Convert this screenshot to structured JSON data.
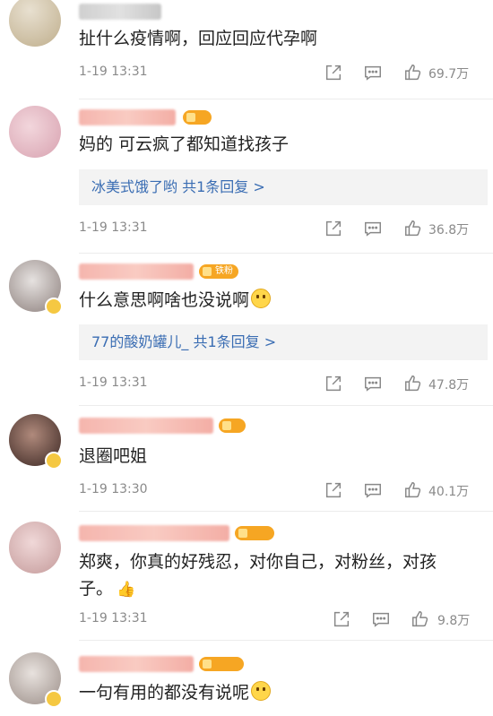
{
  "icons": {
    "share": "share-icon",
    "comment": "comment-icon",
    "like": "thumbs-up-icon"
  },
  "colors": {
    "link": "#3a6db3",
    "meta": "#8a8a8a",
    "badge": "#f6a623"
  },
  "comments": [
    {
      "text": "扯什么疫情啊，回应回应代孕啊",
      "time": "1-19 13:31",
      "likes": "69.7万"
    },
    {
      "text": "妈的 可云疯了都知道找孩子",
      "reply": "冰美式饿了哟  共1条回复 >",
      "time": "1-19 13:31",
      "likes": "36.8万"
    },
    {
      "badge": "铁粉",
      "text": "什么意思啊啥也没说啊",
      "reply": "77的酸奶罐儿_  共1条回复 >",
      "time": "1-19 13:31",
      "likes": "47.8万"
    },
    {
      "text": "退圈吧姐",
      "time": "1-19 13:30",
      "likes": "40.1万"
    },
    {
      "text": "郑爽，你真的好残忍，对你自己，对粉丝，对孩\n子。",
      "time": "1-19 13:31",
      "likes": "9.8万"
    },
    {
      "text": "一句有用的都没有说呢"
    }
  ]
}
